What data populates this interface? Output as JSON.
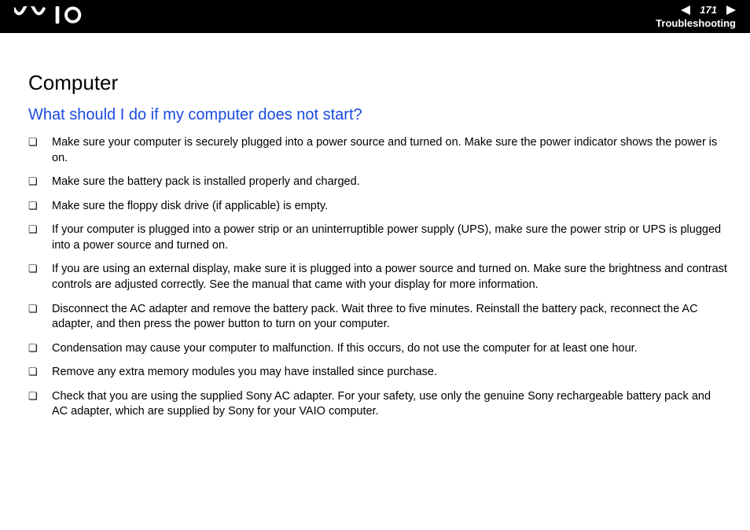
{
  "header": {
    "brand": "VAIO",
    "page_number": "171",
    "section_label": "Troubleshooting"
  },
  "content": {
    "main_heading": "Computer",
    "sub_heading": "What should I do if my computer does not start?",
    "bullets": [
      "Make sure your computer is securely plugged into a power source and turned on. Make sure the power indicator shows the power is on.",
      "Make sure the battery pack is installed properly and charged.",
      "Make sure the floppy disk drive (if applicable) is empty.",
      "If your computer is plugged into a power strip or an uninterruptible power supply (UPS), make sure the power strip or UPS is plugged into a power source and turned on.",
      "If you are using an external display, make sure it is plugged into a power source and turned on. Make sure the brightness and contrast controls are adjusted correctly. See the manual that came with your display for more information.",
      "Disconnect the AC adapter and remove the battery pack. Wait three to five minutes. Reinstall the battery pack, reconnect the AC adapter, and then press the power button to turn on your computer.",
      "Condensation may cause your computer to malfunction. If this occurs, do not use the computer for at least one hour.",
      "Remove any extra memory modules you may have installed since purchase.",
      "Check that you are using the supplied Sony AC adapter. For your safety, use only the genuine Sony rechargeable battery pack and AC adapter, which are supplied by Sony for your VAIO computer."
    ]
  }
}
